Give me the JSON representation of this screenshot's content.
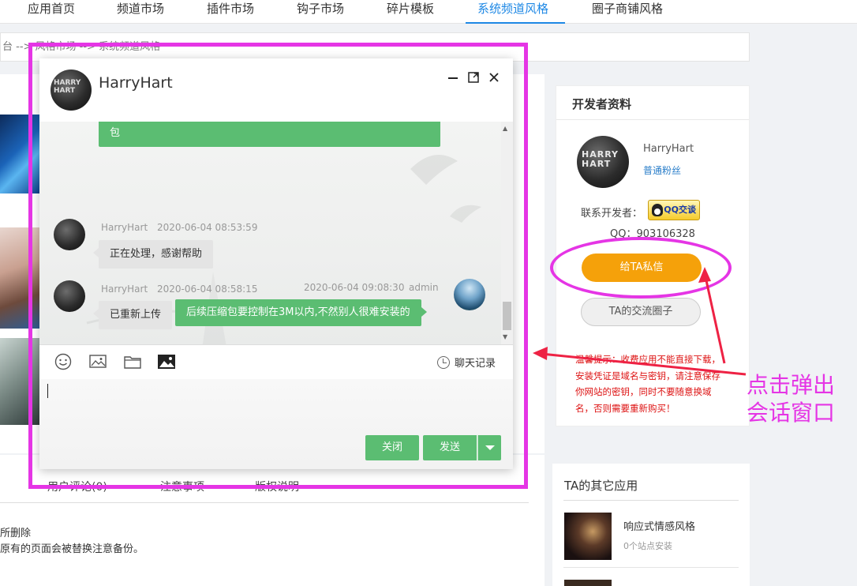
{
  "nav": {
    "items": [
      "应用首页",
      "频道市场",
      "插件市场",
      "钩子市场",
      "碎片模板",
      "系统频道风格",
      "圈子商铺风格"
    ],
    "active_index": 5
  },
  "breadcrumb": {
    "text": "台  -->  风格市场  -->  系统频道风格"
  },
  "lower_tabs": {
    "tabs": [
      "用户评论(0)",
      "注意事项",
      "版权说明"
    ],
    "lines": [
      "所删除",
      "原有的页面会被替换注意备份。"
    ]
  },
  "developer": {
    "title": "开发者资料",
    "name": "HarryHart",
    "level": "普通粉丝",
    "contact_label": "联系开发者：",
    "qq_badge": "QQ交谈",
    "qq_number": "QQ：903106328",
    "pm_button": "给TA私信",
    "circle_button": "TA的交流圈子",
    "tip": "温馨提示：收费应用不能直接下载，安装凭证是域名与密钥，请注意保存你网站的密钥，同时不要随意换域名，否则需要重新购买！"
  },
  "others": {
    "title": "TA的其它应用",
    "apps": [
      {
        "name": "响应式情感风格",
        "installs": "0个站点安装"
      }
    ]
  },
  "chat": {
    "title": "HarryHart",
    "avatar_text": "HARRY HART",
    "messages": [
      {
        "side": "right",
        "text": "包"
      },
      {
        "side": "left",
        "user": "HarryHart",
        "time": "2020-06-04 08:53:59",
        "text": "正在处理，感谢帮助"
      },
      {
        "side": "left",
        "user": "HarryHart",
        "time": "2020-06-04 08:58:15",
        "text": "已重新上传"
      },
      {
        "side": "right",
        "user": "admin",
        "time": "2020-06-04 09:08:30",
        "text": "后续压缩包要控制在3M以内,不然别人很难安装的"
      }
    ],
    "history_label": "聊天记录",
    "close_button": "关闭",
    "send_button": "发送",
    "window_controls": [
      "minimize-icon",
      "maximize-icon",
      "close-icon"
    ],
    "toolbar_icons": [
      "emoji-icon",
      "image-icon",
      "folder-icon",
      "picture-icon"
    ]
  },
  "annotation": {
    "text_line1": "点击弹出",
    "text_line2": "会话窗口",
    "color": "#e535e5"
  },
  "colors": {
    "accent_blue": "#1e88e5",
    "chat_green": "#5bbd72",
    "pm_orange": "#f5a10a",
    "tip_red": "#dd1111"
  }
}
